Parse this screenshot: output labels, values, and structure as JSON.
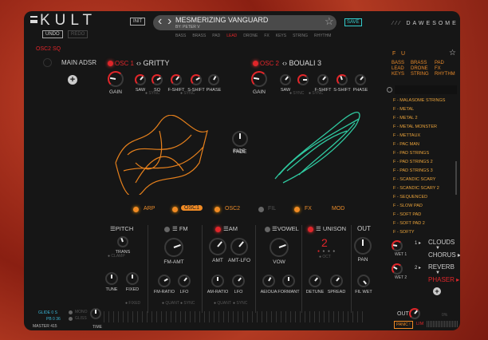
{
  "header": {
    "logo": "KULT",
    "undo": "UNDO",
    "redo": "REDO",
    "init": "INIT",
    "preset_name": "MESMERIZING VANGUARD",
    "preset_author": "BY: PETER V",
    "save": "SAVE",
    "brand": "DAWESOME",
    "categories": [
      "BASS",
      "BRASS",
      "PAD",
      "LEAD",
      "DRONE",
      "FX",
      "KEYS",
      "STRING",
      "RHYTHM"
    ],
    "active_category": "LEAD"
  },
  "mod_target": "OSC2 SQ",
  "adsr": {
    "label": "MAIN ADSR"
  },
  "osc1": {
    "label": "OSC 1",
    "wave": "GRITTY",
    "knobs": [
      "GAIN",
      "SAW",
      "SQ",
      "F-SHIFT",
      "S-SHIFT",
      "PHASE"
    ],
    "toggles": [
      "SYNC",
      "SYNC"
    ]
  },
  "osc2": {
    "label": "OSC 2",
    "wave": "BOUALI 3",
    "knobs": [
      "GAIN",
      "SAW",
      "",
      "F-SHIFT",
      "S-SHIFT",
      "PHASE"
    ],
    "toggles": [
      "SYNC",
      "SYNC"
    ]
  },
  "fade": "FADE",
  "browser": {
    "filters": [
      "F",
      "U"
    ],
    "categories": [
      "BASS",
      "BRASS",
      "PAD",
      "LEAD",
      "DRONE",
      "FX",
      "KEYS",
      "STRING",
      "RHYTHM"
    ],
    "presets": [
      "F - MALASOME STRINGS",
      "F - METAL",
      "F - METAL 2",
      "F - METAL MONSTER",
      "F - METTAUX",
      "F - PAC MAN",
      "F - PAD STRINGS",
      "F - PAD STRINGS 2",
      "F - PAD STRINGS 3",
      "F - SCANDIC SCARY",
      "F - SCANDIC SCARY 2",
      "F - SEQUENCED",
      "F - SLOW PAD",
      "F - SOFT PAD",
      "F - SOFT PAD 2",
      "F - SOFTY"
    ]
  },
  "tabs": [
    "ARP",
    "OSC1",
    "OSC2",
    "FIL",
    "FX",
    "MOD"
  ],
  "active_tab": "OSC1",
  "sections": {
    "pitch": "PITCH",
    "trans": "TRANS",
    "clamp": "CLAMP",
    "tune": "TUNE",
    "fixed": "FIXED",
    "fixed_toggle": "FIXED",
    "fm": "FM",
    "fm_amt": "FM-AMT",
    "fm_ratio": "FM-RATIO",
    "fm_lfo": "LFO",
    "fm_quant": "QUANT",
    "fm_sync": "SYNC",
    "am": "AM",
    "am_amt": "AMT",
    "am_amt_lfo": "AMT-LFO",
    "am_ratio": "AM-RATIO",
    "am_lfo": "LFO",
    "am_quant": "QUANT",
    "am_sync": "SYNC",
    "vowel": "VOWEL",
    "vow": "VOW",
    "aeioua": "AEIOUA",
    "formant": "FORMANT",
    "unison": "UNISON",
    "voices": "2",
    "oct": "OCT",
    "detune": "DETUNE",
    "spread": "SPREAD",
    "out": "OUT",
    "pan": "PAN",
    "fil_wet": "FIL WET"
  },
  "fx": {
    "wet1": "WET 1",
    "wet2": "WET 2",
    "slot1": "1 ▸",
    "slot2": "2 ▸",
    "chain1": [
      "CLOUDS",
      "CHORUS"
    ],
    "chain2": [
      "REVERB",
      "PHASER"
    ]
  },
  "footer": {
    "glide": "GLIDE 0 S",
    "pb": "PB 0 36",
    "master": "MASTER 415",
    "mono": "MONO",
    "gliss": "GLISS",
    "time": "TIME",
    "out": "OUT",
    "panic": "PANIC !",
    "lim": "LIM",
    "cpu": "0%"
  }
}
